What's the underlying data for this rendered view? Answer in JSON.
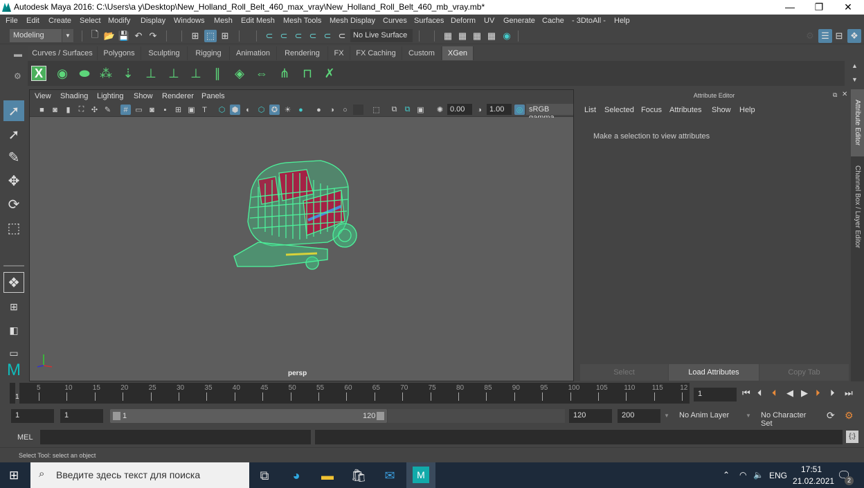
{
  "window": {
    "title": "Autodesk Maya 2016: C:\\Users\\a y\\Desktop\\New_Holland_Roll_Belt_460_max_vray\\New_Holland_Roll_Belt_460_mb_vray.mb*",
    "minimize": "—",
    "restore": "❐",
    "close": "✕"
  },
  "menubar": [
    "File",
    "Edit",
    "Create",
    "Select",
    "Modify",
    "Display",
    "Windows",
    "Mesh",
    "Edit Mesh",
    "Mesh Tools",
    "Mesh Display",
    "Curves",
    "Surfaces",
    "Deform",
    "UV",
    "Generate",
    "Cache",
    "- 3DtoAll -",
    "Help"
  ],
  "statusline": {
    "mode": "Modeling",
    "live_surface": "No Live Surface"
  },
  "shelf": {
    "tabs": [
      "Curves / Surfaces",
      "Polygons",
      "Sculpting",
      "Rigging",
      "Animation",
      "Rendering",
      "FX",
      "FX Caching",
      "Custom",
      "XGen"
    ],
    "active_tab": "XGen",
    "icons": [
      "xgen-x-icon",
      "eye-check-icon",
      "hide-icon",
      "add-guide-icon",
      "place-guide-icon",
      "add-guide-2-icon",
      "guide-eye-icon",
      "lock-guide-icon",
      "rebuild-guide-icon",
      "layers-icon",
      "guide-length-icon",
      "select-guide-icon",
      "guide-frame-icon",
      "delete-guide-icon"
    ]
  },
  "viewport": {
    "menu": [
      "View",
      "Shading",
      "Lighting",
      "Show",
      "Renderer",
      "Panels"
    ],
    "exposure": "0.00",
    "gamma": "1.00",
    "color_space": "sRGB gamma",
    "camera_label": "persp"
  },
  "attribute_editor": {
    "header": "Attribute Editor",
    "menu": [
      "List",
      "Selected",
      "Focus",
      "Attributes",
      "Show",
      "Help"
    ],
    "message": "Make a selection to view attributes",
    "buttons": {
      "select": "Select",
      "load": "Load Attributes",
      "copy": "Copy Tab"
    }
  },
  "side_tabs": [
    "Attribute Editor",
    "Channel Box / Layer Editor"
  ],
  "timeline": {
    "ticks": [
      "5",
      "10",
      "15",
      "20",
      "25",
      "30",
      "35",
      "40",
      "45",
      "50",
      "55",
      "60",
      "65",
      "70",
      "75",
      "80",
      "85",
      "90",
      "95",
      "100",
      "105",
      "110",
      "115",
      "12"
    ],
    "current_frame_marker": "1",
    "current_frame": "1",
    "start_time": "1",
    "playback_start": "1",
    "range_start_label": "1",
    "range_end_label": "120",
    "playback_end": "120",
    "end_time": "200",
    "anim_layer": "No Anim Layer",
    "character_set": "No Character Set"
  },
  "command_line": {
    "label": "MEL",
    "value": ""
  },
  "help_line": "Select Tool: select an object",
  "taskbar": {
    "search_placeholder": "Введите здесь текст для поиска",
    "language": "ENG",
    "time": "17:51",
    "date": "21.02.2021",
    "notifications": "2"
  }
}
